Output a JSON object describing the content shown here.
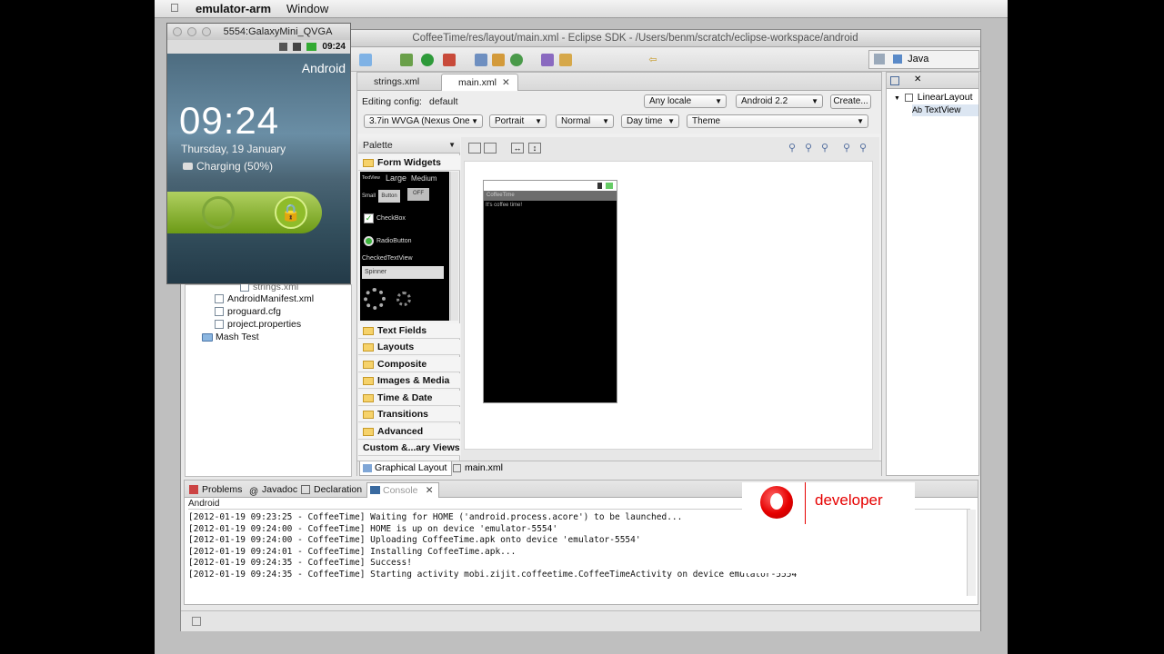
{
  "menubar": {
    "app": "emulator-arm",
    "window": "Window"
  },
  "ide": {
    "title": "CoffeeTime/res/layout/main.xml - Eclipse SDK - /Users/benm/scratch/eclipse-workspace/android",
    "perspective": "Java"
  },
  "emulator": {
    "title": "5554:GalaxyMini_QVGA",
    "status_time": "09:24",
    "carrier": "Android",
    "clock": "09:24",
    "date": "Thursday, 19 January",
    "charging": "Charging (50%)"
  },
  "explorer": {
    "items": [
      "strings.xml",
      "AndroidManifest.xml",
      "proguard.cfg",
      "project.properties",
      "Mash Test"
    ]
  },
  "editor": {
    "tabs": [
      {
        "label": "strings.xml"
      },
      {
        "label": "main.xml"
      }
    ],
    "config_label": "Editing config:",
    "config_value": "default",
    "locale": "Any locale",
    "target": "Android 2.2",
    "create": "Create...",
    "device": "3.7in WVGA (Nexus One",
    "orientation": "Portrait",
    "dock": "Normal",
    "night": "Day time",
    "theme": "Theme",
    "palette": "Palette",
    "form_widgets": "Form Widgets",
    "categories": [
      "Text Fields",
      "Layouts",
      "Composite",
      "Images & Media",
      "Time & Date",
      "Transitions",
      "Advanced",
      "Custom &...ary Views"
    ],
    "widget_labels": {
      "textview": "TextView",
      "large": "Large",
      "medium": "Medium",
      "small": "Small",
      "button": "Button",
      "off": "OFF",
      "checkbox": "CheckBox",
      "radiobutton": "RadioButton",
      "checkedtextview": "CheckedTextView",
      "spinner": "Spinner"
    },
    "device_title": "CoffeeTime",
    "device_text": "It's coffee time!",
    "subtabs": [
      "Graphical Layout",
      "main.xml"
    ]
  },
  "outline": {
    "root": "LinearLayout",
    "child": "TextView"
  },
  "bottom": {
    "tabs": [
      "Problems",
      "Javadoc",
      "Declaration",
      "Console"
    ],
    "console_name": "Android",
    "lines": [
      "[2012-01-19 09:23:25 - CoffeeTime] Waiting for HOME ('android.process.acore') to be launched...",
      "[2012-01-19 09:24:00 - CoffeeTime] HOME is up on device 'emulator-5554'",
      "[2012-01-19 09:24:00 - CoffeeTime] Uploading CoffeeTime.apk onto device 'emulator-5554'",
      "[2012-01-19 09:24:01 - CoffeeTime] Installing CoffeeTime.apk...",
      "[2012-01-19 09:24:35 - CoffeeTime] Success!",
      "[2012-01-19 09:24:35 - CoffeeTime] Starting activity mobi.zijit.coffeetime.CoffeeTimeActivity on device emulator-5554"
    ]
  },
  "watermark": {
    "text": "developer",
    "accent": "#e60000"
  }
}
